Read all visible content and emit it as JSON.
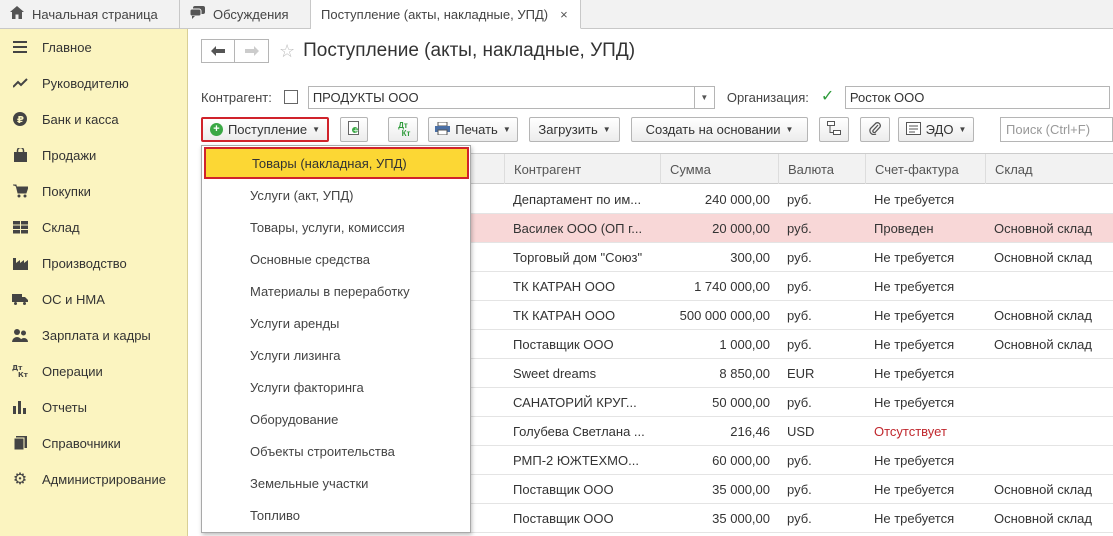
{
  "tabs": [
    {
      "label": "Начальная страница",
      "icon": "home-icon"
    },
    {
      "label": "Обсуждения",
      "icon": "chat-icon"
    },
    {
      "label": "Поступление (акты, накладные, УПД)",
      "close": "×"
    }
  ],
  "sidebar": {
    "items": [
      {
        "label": "Главное",
        "icon": "menu-icon"
      },
      {
        "label": "Руководителю",
        "icon": "trend-icon"
      },
      {
        "label": "Банк и касса",
        "icon": "coin-icon"
      },
      {
        "label": "Продажи",
        "icon": "bag-icon"
      },
      {
        "label": "Покупки",
        "icon": "cart-icon"
      },
      {
        "label": "Склад",
        "icon": "grid-icon"
      },
      {
        "label": "Производство",
        "icon": "factory-icon"
      },
      {
        "label": "ОС и НМА",
        "icon": "truck-icon"
      },
      {
        "label": "Зарплата и кадры",
        "icon": "people-icon"
      },
      {
        "label": "Операции",
        "icon": "dt-kt-icon"
      },
      {
        "label": "Отчеты",
        "icon": "bar-chart-icon"
      },
      {
        "label": "Справочники",
        "icon": "book-icon"
      },
      {
        "label": "Администрирование",
        "icon": "gear-icon"
      }
    ]
  },
  "header": {
    "back": "🡐",
    "forward": "🡒",
    "title": "Поступление (акты, накладные, УПД)"
  },
  "filters": {
    "kontragent_label": "Контрагент:",
    "kontragent_value": "ПРОДУКТЫ ООО",
    "org_label": "Организация:",
    "org_value": "Росток ООО"
  },
  "toolbar": {
    "postuplenie": "Поступление",
    "dt": "Дт",
    "kt": "Кт",
    "print": "Печать",
    "load": "Загрузить",
    "create_based": "Создать на основании",
    "edo": "ЭДО",
    "search_placeholder": "Поиск (Ctrl+F)"
  },
  "table": {
    "columns": [
      "Контрагент",
      "Сумма",
      "Валюта",
      "Счет-фактура",
      "Склад"
    ],
    "rows": [
      {
        "k": "Департамент по им...",
        "sum": "240 000,00",
        "cur": "руб.",
        "sf": "Не требуется",
        "sklad": "",
        "pink": false,
        "red": false
      },
      {
        "k": "Василек ООО (ОП г...",
        "sum": "20 000,00",
        "cur": "руб.",
        "sf": "Проведен",
        "sklad": "Основной склад",
        "pink": true,
        "red": false
      },
      {
        "k": "Торговый дом \"Союз\"",
        "sum": "300,00",
        "cur": "руб.",
        "sf": "Не требуется",
        "sklad": "Основной склад",
        "pink": false,
        "red": false
      },
      {
        "k": "ТК КАТРАН ООО",
        "sum": "1 740 000,00",
        "cur": "руб.",
        "sf": "Не требуется",
        "sklad": "",
        "pink": false,
        "red": false
      },
      {
        "k": "ТК КАТРАН ООО",
        "sum": "500 000 000,00",
        "cur": "руб.",
        "sf": "Не требуется",
        "sklad": "Основной склад",
        "pink": false,
        "red": false
      },
      {
        "k": "Поставщик ООО",
        "sum": "1 000,00",
        "cur": "руб.",
        "sf": "Не требуется",
        "sklad": "Основной склад",
        "pink": false,
        "red": false
      },
      {
        "k": "Sweet dreams",
        "sum": "8 850,00",
        "cur": "EUR",
        "sf": "Не требуется",
        "sklad": "",
        "pink": false,
        "red": false
      },
      {
        "k": "САНАТОРИЙ КРУГ...",
        "sum": "50 000,00",
        "cur": "руб.",
        "sf": "Не требуется",
        "sklad": "",
        "pink": false,
        "red": false
      },
      {
        "k": "Голубева Светлана ...",
        "sum": "216,46",
        "cur": "USD",
        "sf": "Отсутствует",
        "sklad": "",
        "pink": false,
        "red": true
      },
      {
        "k": "РМП-2 ЮЖТЕХМО...",
        "sum": "60 000,00",
        "cur": "руб.",
        "sf": "Не требуется",
        "sklad": "",
        "pink": false,
        "red": false
      },
      {
        "k": "Поставщик ООО",
        "sum": "35 000,00",
        "cur": "руб.",
        "sf": "Не требуется",
        "sklad": "Основной склад",
        "pink": false,
        "red": false
      },
      {
        "k": "Поставщик ООО",
        "sum": "35 000,00",
        "cur": "руб.",
        "sf": "Не требуется",
        "sklad": "Основной склад",
        "pink": false,
        "red": false
      }
    ]
  },
  "menu": {
    "items": [
      "Товары (накладная, УПД)",
      "Услуги (акт, УПД)",
      "Товары, услуги, комиссия",
      "Основные средства",
      "Материалы в переработку",
      "Услуги аренды",
      "Услуги лизинга",
      "Услуги факторинга",
      "Оборудование",
      "Объекты строительства",
      "Земельные участки",
      "Топливо"
    ]
  },
  "colors": {
    "sidebar_bg": "#fbf4c0",
    "highlight": "#fcd734",
    "outline_red": "#d0232b",
    "pink_row": "#f8d7d7",
    "status_red": "#c0272d"
  }
}
